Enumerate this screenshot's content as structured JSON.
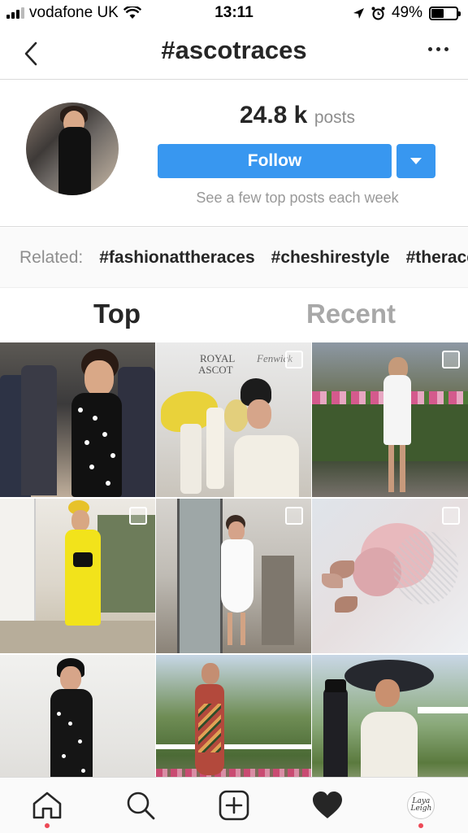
{
  "status_bar": {
    "carrier": "vodafone UK",
    "time": "13:11",
    "battery_percent": "49%",
    "battery_level": 0.49
  },
  "nav": {
    "title": "#ascotraces",
    "back_icon": "chevron-left-icon",
    "more_icon": "more-horizontal-icon"
  },
  "profile": {
    "posts_count": "24.8 k",
    "posts_label": "posts",
    "follow_label": "Follow",
    "follow_note": "See a few top posts each week"
  },
  "related": {
    "label": "Related:",
    "tags": [
      "#fashionattheraces",
      "#cheshirestyle",
      "#theraces"
    ]
  },
  "tabs": {
    "top": "Top",
    "recent": "Recent",
    "active": "top"
  },
  "grid": {
    "tiles": [
      {
        "id": 1,
        "multi": false,
        "subject": "woman-polka-dot-dress"
      },
      {
        "id": 2,
        "multi": true,
        "subject": "royal-ascot-hats",
        "caption_a": "ROYAL",
        "caption_b": "ASCOT",
        "caption_c": "Fenwick"
      },
      {
        "id": 3,
        "multi": true,
        "subject": "woman-white-dress-racecourse"
      },
      {
        "id": 4,
        "multi": true,
        "subject": "woman-yellow-dress"
      },
      {
        "id": 5,
        "multi": true,
        "subject": "woman-white-ruffle-dress"
      },
      {
        "id": 6,
        "multi": true,
        "subject": "pink-butterfly-fascinator"
      },
      {
        "id": 7,
        "multi": false,
        "subject": "woman-black-dress-marble"
      },
      {
        "id": 8,
        "multi": false,
        "subject": "woman-floral-dress-course"
      },
      {
        "id": 9,
        "multi": false,
        "subject": "woman-feather-hat"
      }
    ]
  },
  "tabbar": {
    "items": [
      {
        "name": "home",
        "icon": "home-icon",
        "dot": true
      },
      {
        "name": "search",
        "icon": "search-icon",
        "dot": false
      },
      {
        "name": "new-post",
        "icon": "plus-square-icon",
        "dot": false
      },
      {
        "name": "activity",
        "icon": "heart-icon",
        "dot": false
      },
      {
        "name": "profile",
        "icon": "profile-avatar",
        "dot": true,
        "avatar_text": "Laya Leigh"
      }
    ]
  },
  "colors": {
    "accent": "#3897f0",
    "notification_dot": "#ed4956",
    "text_primary": "#262626",
    "text_secondary": "#8e8e8e"
  }
}
